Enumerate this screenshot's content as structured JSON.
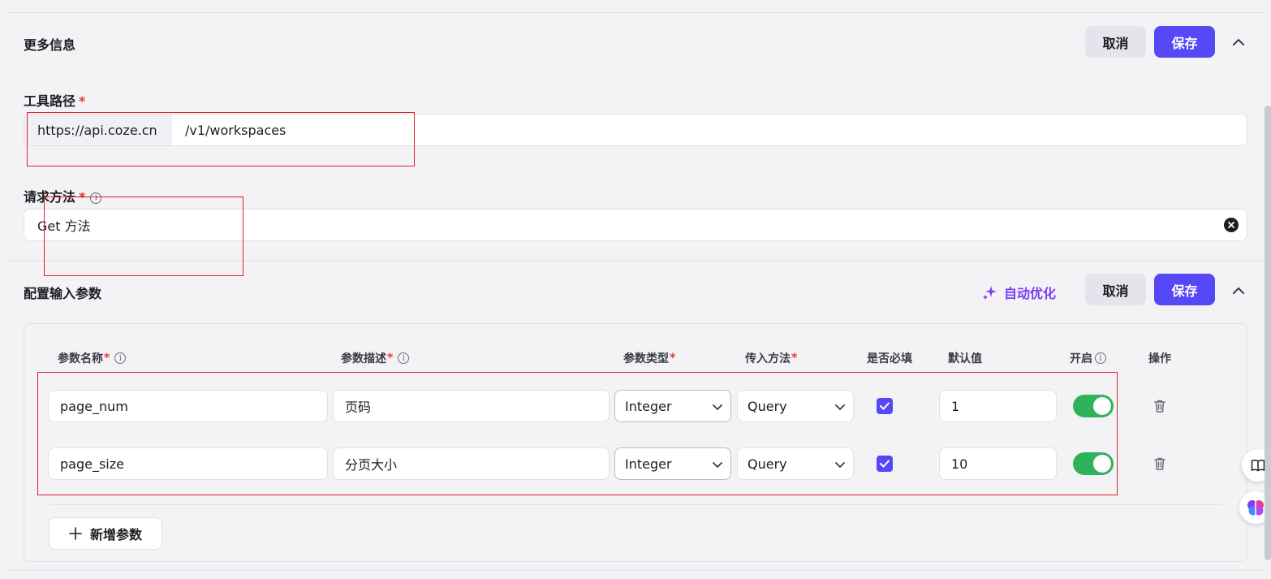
{
  "more_info": {
    "title": "更多信息",
    "cancel_label": "取消",
    "save_label": "保存",
    "tool_path_label": "工具路径",
    "url_prefix": "https://api.coze.cn",
    "url_path": "/v1/workspaces",
    "method_label": "请求方法",
    "method_value": "Get 方法"
  },
  "input_params": {
    "title": "配置输入参数",
    "auto_optimize_label": "自动优化",
    "cancel_label": "取消",
    "save_label": "保存",
    "headers": {
      "name": "参数名称",
      "description": "参数描述",
      "type": "参数类型",
      "method": "传入方法",
      "required": "是否必填",
      "default": "默认值",
      "enabled": "开启",
      "actions": "操作"
    },
    "rows": [
      {
        "name": "page_num",
        "description": "页码",
        "type": "Integer",
        "method": "Query",
        "required": true,
        "default": "1",
        "enabled": true
      },
      {
        "name": "page_size",
        "description": "分页大小",
        "type": "Integer",
        "method": "Query",
        "required": true,
        "default": "10",
        "enabled": true
      }
    ],
    "add_param_label": "新增参数"
  },
  "icons": {
    "collapse": "chevron-up-icon",
    "info": "info-icon",
    "clear": "clear-icon",
    "sparkle": "sparkle-icon",
    "dropdown": "chevron-down-icon",
    "check": "check-icon",
    "trash": "trash-icon",
    "plus": "plus-icon",
    "book": "book-icon",
    "brain": "brain-icon"
  },
  "colors": {
    "primary": "#5548f6",
    "toggle_on": "#2fb35a",
    "auto_optimize": "#7b3df6",
    "required_mark": "#e53935",
    "annotation": "#e0202a"
  }
}
